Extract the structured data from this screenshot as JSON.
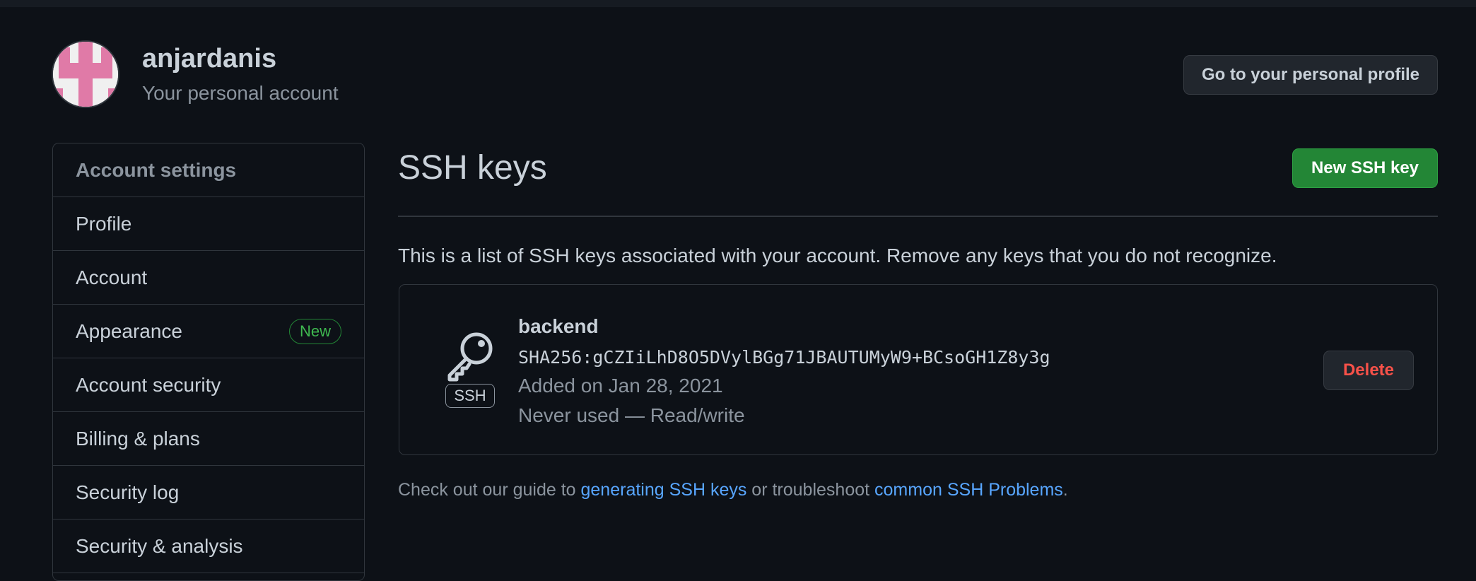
{
  "header": {
    "username": "anjardanis",
    "account_subtitle": "Your personal account",
    "profile_button": "Go to your personal profile"
  },
  "sidebar": {
    "heading": "Account settings",
    "items": [
      {
        "label": "Profile"
      },
      {
        "label": "Account"
      },
      {
        "label": "Appearance",
        "badge": "New"
      },
      {
        "label": "Account security"
      },
      {
        "label": "Billing & plans"
      },
      {
        "label": "Security log"
      },
      {
        "label": "Security & analysis"
      }
    ]
  },
  "main": {
    "title": "SSH keys",
    "new_button": "New SSH key",
    "description": "This is a list of SSH keys associated with your account. Remove any keys that you do not recognize.",
    "keys": [
      {
        "type_label": "SSH",
        "name": "backend",
        "fingerprint": "SHA256:gCZIiLhD8O5DVylBGg71JBAUTUMyW9+BCsoGH1Z8y3g",
        "added": "Added on Jan 28, 2021",
        "usage": "Never used — Read/write",
        "delete_label": "Delete"
      }
    ],
    "footer": {
      "prefix": "Check out our guide to ",
      "link1": "generating SSH keys",
      "middle": " or troubleshoot ",
      "link2": "common SSH Problems",
      "suffix": "."
    }
  },
  "colors": {
    "background": "#0d1117",
    "primary_button": "#238636",
    "link": "#58a6ff",
    "danger": "#f85149",
    "badge_green": "#3fb950"
  },
  "icons": {
    "avatar": "identicon-avatar",
    "key": "key-icon"
  }
}
